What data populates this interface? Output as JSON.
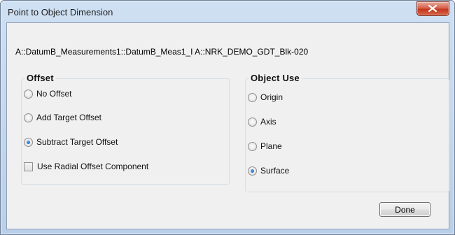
{
  "window": {
    "title": "Point to Object Dimension"
  },
  "path_text": "A::DatumB_Measurements1::DatumB_Meas1_I  A::NRK_DEMO_GDT_Blk-020",
  "offset_group": {
    "title": "Offset",
    "options": [
      {
        "label": "No Offset",
        "checked": false
      },
      {
        "label": "Add Target Offset",
        "checked": false
      },
      {
        "label": "Subtract Target Offset",
        "checked": true
      }
    ],
    "checkbox": {
      "label": "Use Radial Offset Component",
      "checked": false
    }
  },
  "object_use_group": {
    "title": "Object Use",
    "options": [
      {
        "label": "Origin",
        "checked": false
      },
      {
        "label": "Axis",
        "checked": false
      },
      {
        "label": "Plane",
        "checked": false
      },
      {
        "label": "Surface",
        "checked": true
      }
    ]
  },
  "buttons": {
    "done": "Done"
  },
  "icons": {
    "close": "close-icon"
  }
}
